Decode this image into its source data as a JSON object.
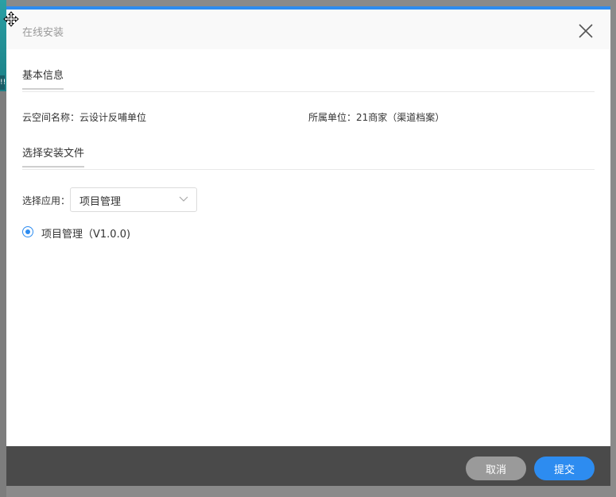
{
  "dialog": {
    "title": "在线安装",
    "accent_color": "#2d8cf0"
  },
  "basic_info": {
    "section_title": "基本信息",
    "space_name": "云空间名称：云设计反哺单位",
    "unit": "所属单位：21商家（渠道档案）"
  },
  "install_files": {
    "section_title": "选择安装文件",
    "select_label": "选择应用：",
    "selected_app": "项目管理",
    "radio_option": "项目管理（V1.0.0)"
  },
  "footer": {
    "cancel_label": "取消",
    "submit_label": "提交"
  },
  "icons": {
    "close": "close-icon",
    "dropdown": "chevron-down-icon",
    "cursor": "move-cursor-icon"
  }
}
